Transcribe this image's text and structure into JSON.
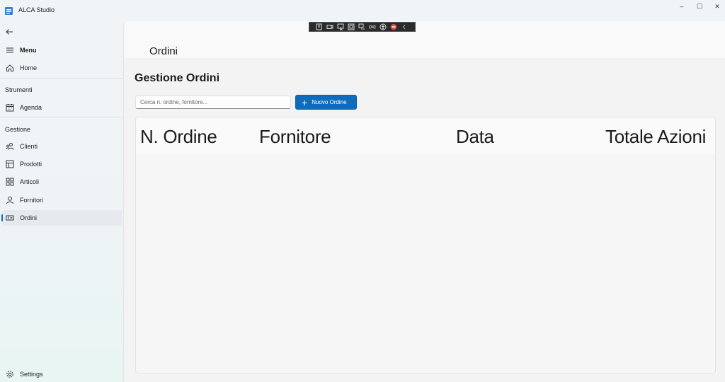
{
  "window": {
    "title": "ALCA Studio",
    "controls": {
      "minimize": "–",
      "maximize": "☐",
      "close": "✕"
    }
  },
  "sidebar": {
    "menu_label": "Menu",
    "home_label": "Home",
    "strumenti_header": "Strumenti",
    "agenda_label": "Agenda",
    "gestione_header": "Gestione",
    "items": [
      {
        "label": "Clienti",
        "icon": "people-icon"
      },
      {
        "label": "Prodotti",
        "icon": "box-icon"
      },
      {
        "label": "Articoli",
        "icon": "grid-icon"
      },
      {
        "label": "Fornitori",
        "icon": "person-icon"
      },
      {
        "label": "Ordini",
        "icon": "cart-icon",
        "selected": true
      }
    ],
    "settings_label": "Settings"
  },
  "page": {
    "title": "Ordini",
    "section_title": "Gestione Ordini",
    "search": {
      "placeholder": "Cerca n. ordine, fornitore...",
      "value": ""
    },
    "new_order_label": "Nuovo Ordine",
    "table": {
      "columns": [
        "N. Ordine",
        "Fornitore",
        "Data",
        "Totale Azioni"
      ],
      "rows": []
    }
  },
  "colors": {
    "accent": "#0f6cbd",
    "selected_nav_bg": "#e6eaee"
  }
}
